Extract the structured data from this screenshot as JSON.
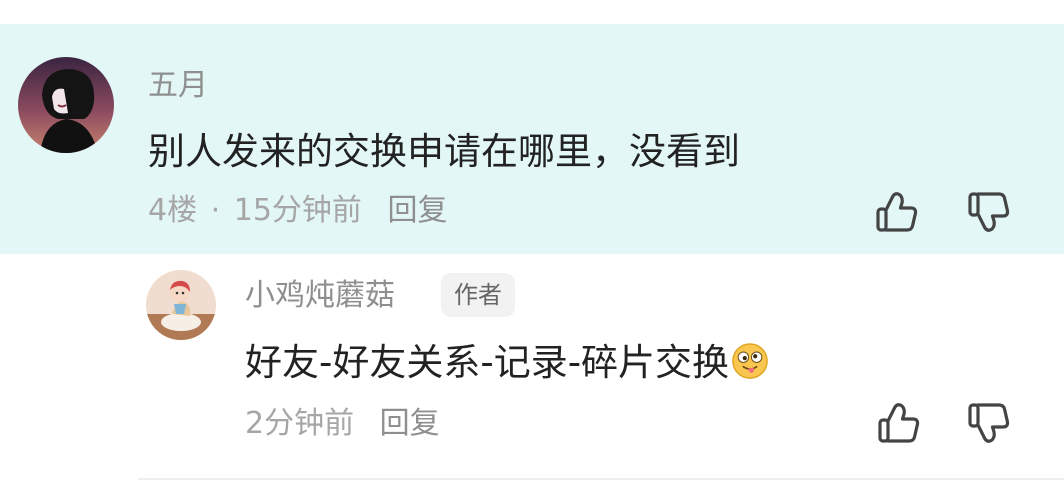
{
  "main_comment": {
    "username": "五月",
    "text": "别人发来的交换申请在哪里，没看到",
    "floor": "4楼",
    "separator": "·",
    "time": "15分钟前",
    "reply_label": "回复"
  },
  "reply_comment": {
    "username": "小鸡炖蘑菇",
    "badge": "作者",
    "text": "好友-好友关系-记录-碎片交换",
    "time": "2分钟前",
    "reply_label": "回复"
  },
  "icons": {
    "like": "thumbs-up-icon",
    "dislike": "thumbs-down-icon",
    "sticker": "silly-face-emoji-icon"
  },
  "colors": {
    "highlight_bg": "#e3f7f7",
    "username": "#8f8f8f",
    "text": "#222222",
    "meta": "#a6a6a6"
  }
}
